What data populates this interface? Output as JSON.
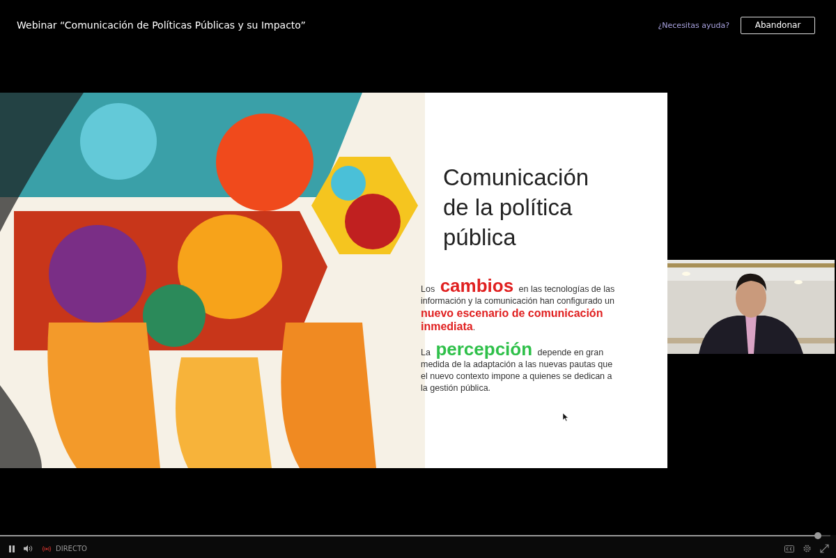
{
  "window": {
    "title": "Webinar “Comunicación de Políticas Públicas y su Impacto”"
  },
  "header": {
    "help_link": "¿Necesitas ayuda?",
    "leave_button": "Abandonar"
  },
  "slide": {
    "title": "Comunicación de la política pública",
    "paragraphs": [
      {
        "text": "Los **cambios** en las tecnologías de las información y la comunicación han configurado un **nuevo escenario de comunicación inmediata**.",
        "color": "#e02020"
      },
      {
        "text": "La **percepción** depende en gran medida de la adaptación a las nuevas pautas que el nuevo contexto impone a quienes se dedican a la gestión pública.",
        "color": "#2fc04a"
      }
    ]
  },
  "player": {
    "status_label": "DIRECTO",
    "level": 0.985
  }
}
